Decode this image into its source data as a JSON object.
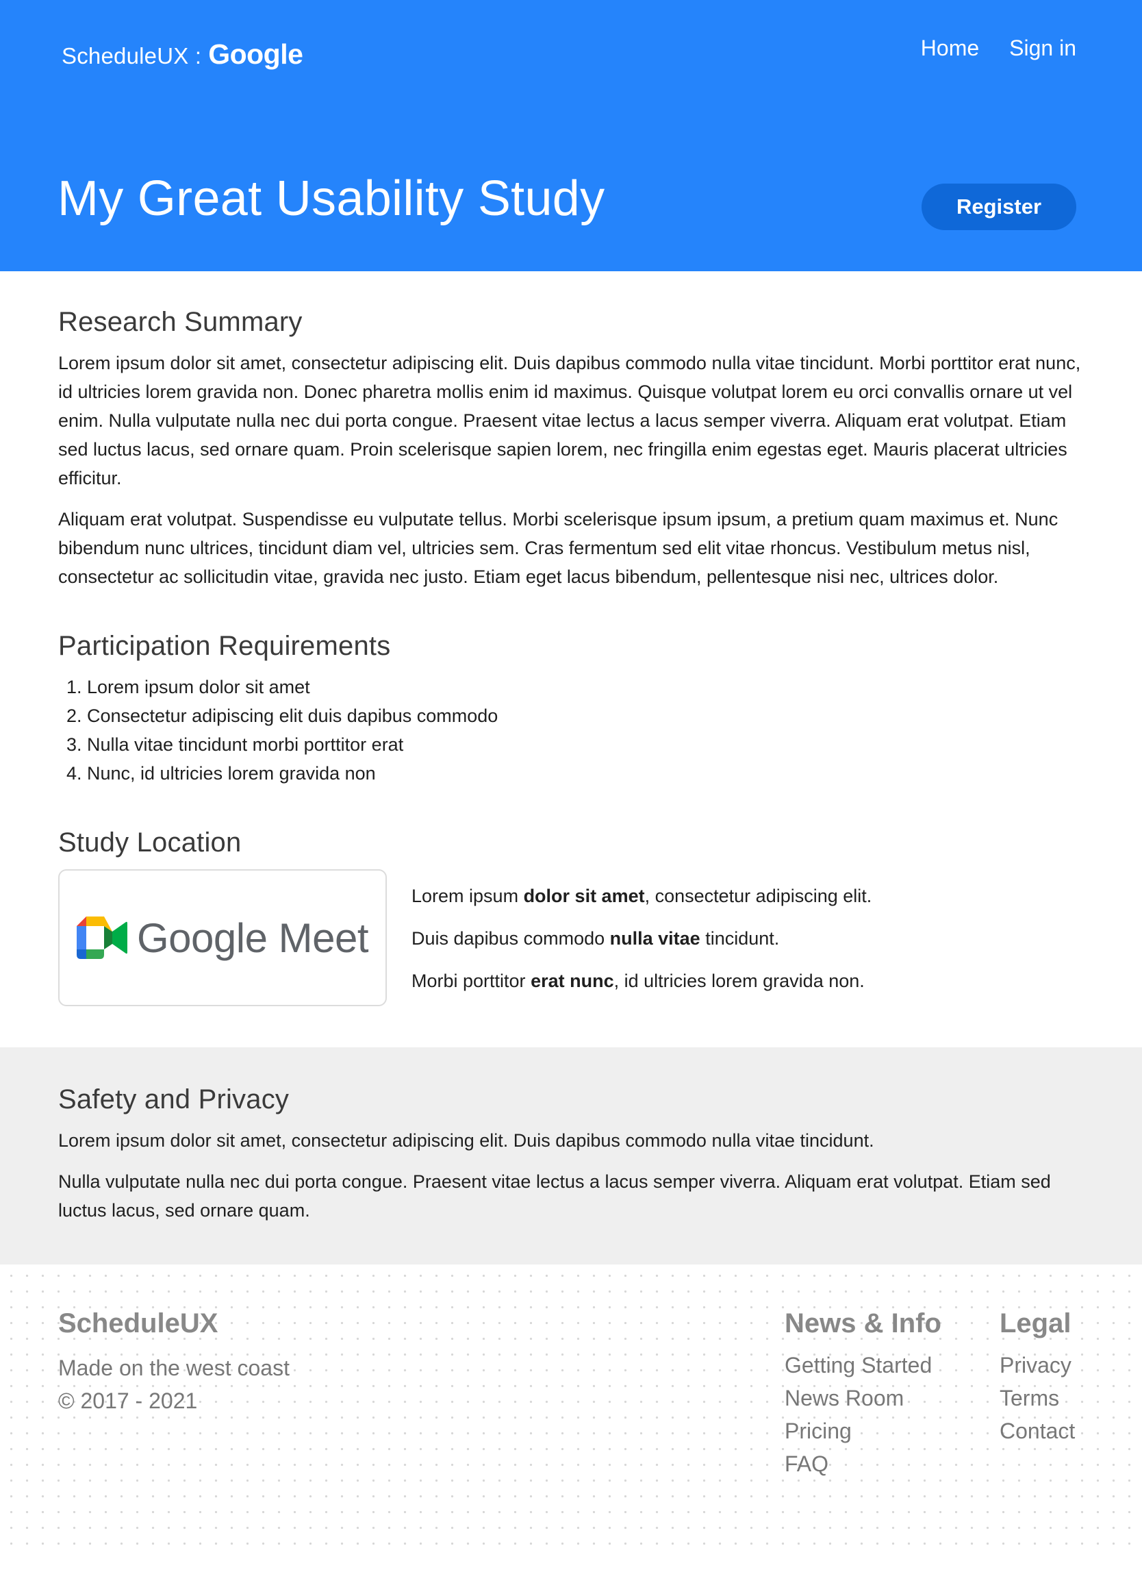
{
  "header": {
    "brand_app": "ScheduleUX :",
    "brand_word": "Google",
    "nav": [
      "Home",
      "Sign in"
    ],
    "title": "My Great Usability Study",
    "register_label": "Register"
  },
  "research": {
    "heading": "Research Summary",
    "paragraphs": [
      "Lorem ipsum dolor sit amet, consectetur adipiscing elit. Duis dapibus commodo nulla vitae tincidunt. Morbi porttitor erat nunc, id ultricies lorem gravida non. Donec pharetra mollis enim id maximus. Quisque volutpat lorem eu orci convallis ornare ut vel enim. Nulla vulputate nulla nec dui porta congue. Praesent vitae lectus a lacus semper viverra. Aliquam erat volutpat. Etiam sed luctus lacus, sed ornare quam. Proin scelerisque sapien lorem, nec fringilla enim egestas eget. Mauris placerat ultricies efficitur.",
      "Aliquam erat volutpat. Suspendisse eu vulputate tellus. Morbi scelerisque ipsum ipsum, a pretium quam maximus et. Nunc bibendum nunc ultrices, tincidunt diam vel, ultricies sem. Cras fermentum sed elit vitae rhoncus. Vestibulum metus nisl, consectetur ac sollicitudin vitae, gravida nec justo. Etiam eget lacus bibendum, pellentesque nisi nec, ultrices dolor."
    ]
  },
  "participation": {
    "heading": "Participation Requirements",
    "items": [
      "Lorem ipsum dolor sit amet",
      "Consectetur adipiscing elit duis dapibus commodo",
      "Nulla vitae tincidunt morbi porttitor erat",
      "Nunc, id ultricies lorem gravida non"
    ]
  },
  "location": {
    "heading": "Study Location",
    "logo_text": "Google Meet",
    "notes": [
      {
        "before": "Lorem ipsum ",
        "bold": "dolor sit amet",
        "after": ", consectetur adipiscing elit."
      },
      {
        "before": "Duis dapibus commodo ",
        "bold": "nulla vitae",
        "after": " tincidunt."
      },
      {
        "before": "Morbi porttitor ",
        "bold": "erat nunc",
        "after": ", id ultricies lorem gravida non."
      }
    ]
  },
  "safety": {
    "heading": "Safety and Privacy",
    "paragraphs": [
      "Lorem ipsum dolor sit amet, consectetur adipiscing elit. Duis dapibus commodo nulla vitae tincidunt.",
      "Nulla vulputate nulla nec dui porta congue. Praesent vitae lectus a lacus semper viverra. Aliquam erat volutpat. Etiam sed luctus lacus, sed ornare quam."
    ]
  },
  "footer": {
    "brand_title": "ScheduleUX",
    "brand_lines": [
      "Made on the west coast",
      "© 2017 - 2021"
    ],
    "news": {
      "title": "News & Info",
      "links": [
        "Getting Started",
        "News Room",
        "Pricing",
        "FAQ"
      ]
    },
    "legal": {
      "title": "Legal",
      "links": [
        "Privacy",
        "Terms",
        "Contact"
      ]
    }
  },
  "colors": {
    "header_bg": "#2584fb",
    "register_bg": "#0f68d8",
    "safety_bg": "#efefef"
  },
  "icons": [
    "google-meet-icon"
  ]
}
